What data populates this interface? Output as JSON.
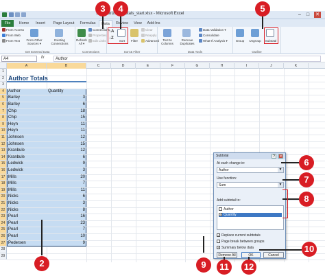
{
  "window": {
    "title": "SummarizeSubtotals_start.xlsx - Microsoft Excel",
    "controls": [
      "–",
      "□",
      "✕"
    ]
  },
  "tabs": [
    "File",
    "Home",
    "Insert",
    "Page Layout",
    "Formulas",
    "Data",
    "Review",
    "View",
    "Add-Ins"
  ],
  "ribbon": {
    "get_external": {
      "items": [
        "From Access",
        "From Web",
        "From Text"
      ],
      "other": "From Other Sources ▾",
      "existing": "Existing Connections",
      "label": "Get External Data"
    },
    "connections": {
      "refresh": "Refresh All ▾",
      "items": [
        "Connections",
        "Properties",
        "Edit Links"
      ],
      "label": "Connections"
    },
    "sort_filter": {
      "sort": "Sort",
      "filter": "Filter",
      "items": [
        "Clear",
        "Reapply",
        "Advanced"
      ],
      "label": "Sort & Filter"
    },
    "data_tools": {
      "text_to_columns": "Text to Columns",
      "remove_duplicates": "Remove Duplicates",
      "items": [
        "Data Validation ▾",
        "Consolidate",
        "What-If Analysis ▾"
      ],
      "label": "Data Tools"
    },
    "outline": {
      "group": "Group",
      "ungroup": "Ungroup",
      "subtotal": "Subtotal",
      "label": "Outline"
    }
  },
  "formula_bar": {
    "name_box": "A4",
    "fx": "fx",
    "value": "Author"
  },
  "columns": [
    "A",
    "B",
    "C",
    "D",
    "E",
    "F",
    "G",
    "H",
    "I",
    "J",
    "K"
  ],
  "sheet": {
    "title": "Author Totals",
    "header": [
      "Author",
      "Quantity"
    ],
    "rows": [
      [
        "Barley",
        "3"
      ],
      [
        "Barley",
        "6"
      ],
      [
        "Chip",
        "18"
      ],
      [
        "Chip",
        "15"
      ],
      [
        "Heyn",
        "11"
      ],
      [
        "Heyn",
        "11"
      ],
      [
        "Johnsen",
        "12"
      ],
      [
        "Johnsen",
        "15"
      ],
      [
        "Kranbule",
        "12"
      ],
      [
        "Kranbule",
        "6"
      ],
      [
        "Ledwick",
        "9"
      ],
      [
        "Ledwick",
        "3"
      ],
      [
        "Mills",
        "20"
      ],
      [
        "Mills",
        "7"
      ],
      [
        "Mills",
        "11"
      ],
      [
        "Nicks",
        "6"
      ],
      [
        "Nicks",
        "3"
      ],
      [
        "Nicks",
        "8"
      ],
      [
        "Pearl",
        "16"
      ],
      [
        "Pearl",
        "23"
      ],
      [
        "Pearl",
        "7"
      ],
      [
        "Pearl",
        "10"
      ],
      [
        "Pedersen",
        "9"
      ]
    ]
  },
  "dialog": {
    "title": "Subtotal",
    "help": "?",
    "close": "✕",
    "change_label": "At each change in:",
    "change_value": "Author",
    "function_label": "Use function:",
    "function_value": "Sum",
    "add_label": "Add subtotal to:",
    "list": [
      "Author",
      "Quantity"
    ],
    "options": [
      "Replace current subtotals",
      "Page break between groups",
      "Summary below data"
    ],
    "buttons": {
      "remove_all": "Remove All",
      "ok": "OK",
      "cancel": "Cancel"
    }
  },
  "callouts": [
    "2",
    "3",
    "4",
    "5",
    "6",
    "7",
    "8",
    "9",
    "10",
    "11",
    "12"
  ],
  "colors": {
    "callout": "#d81d24",
    "selection": "#c6dcf2",
    "file_tab": "#2a7d3c",
    "title_text": "#1f497d"
  }
}
